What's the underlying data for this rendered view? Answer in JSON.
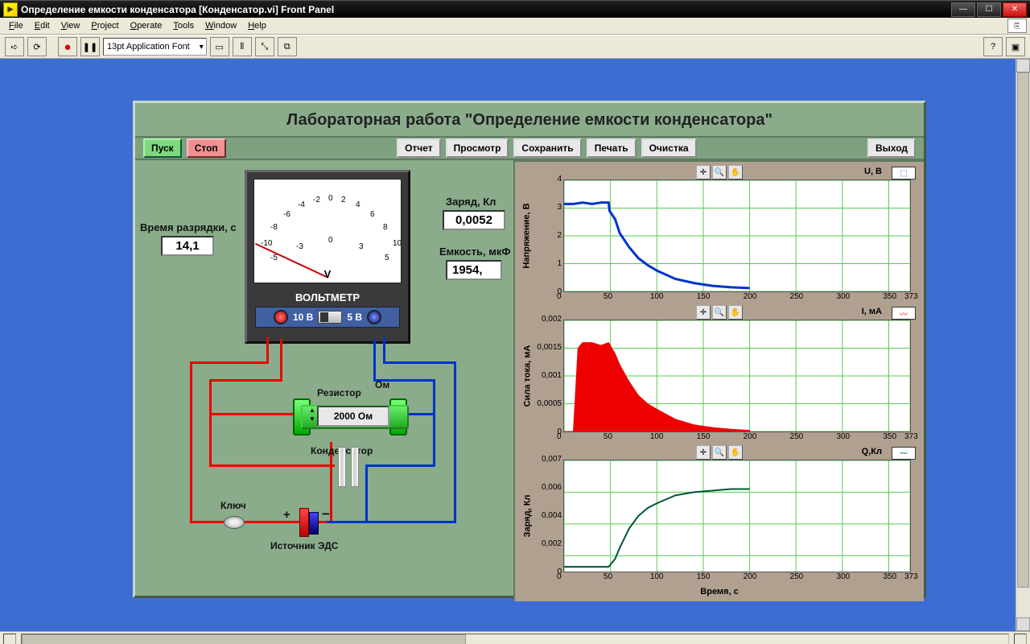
{
  "window": {
    "title": "Определение емкости конденсатора [Конденсатор.vi] Front Panel"
  },
  "menu": {
    "file": "File",
    "edit": "Edit",
    "view": "View",
    "project": "Project",
    "operate": "Operate",
    "tools": "Tools",
    "window": "Window",
    "help": "Help"
  },
  "toolbar": {
    "font": "13pt Application Font"
  },
  "panel": {
    "title": "Лабораторная работа \"Определение емкости конденсатора\""
  },
  "buttons": {
    "start": "Пуск",
    "stop": "Стоп",
    "report": "Отчет",
    "preview": "Просмотр",
    "save": "Сохранить",
    "print": "Печать",
    "clear": "Очистка",
    "exit": "Выход"
  },
  "labels": {
    "discharge_time": "Время разрядки, с",
    "charge": "Заряд, Кл",
    "capacity": "Емкость, мкФ",
    "voltmeter": "ВОЛЬТМЕТР",
    "v": "V",
    "r10": "10 В",
    "r5": "5 В",
    "resistor": "Резистор",
    "ohm": "Ом",
    "capacitor": "Конденсатор",
    "switch": "Ключ",
    "source": "Источник ЭДС",
    "plus": "+",
    "minus": "−"
  },
  "values": {
    "time": "14,1",
    "charge": "0,0052",
    "capacity": "1954,",
    "resistor": "2000 Ом"
  },
  "scale": {
    "n5": "-5",
    "n3": "-3",
    "0": "0",
    "3": "3",
    "5": "5",
    "top": {
      "n10": "-10",
      "n8": "-8",
      "n6": "-6",
      "n4": "-4",
      "n2": "-2",
      "0": "0",
      "2": "2",
      "4": "4",
      "6": "6",
      "8": "8",
      "10": "10"
    }
  },
  "graphs": {
    "g1": {
      "title": "U, В",
      "ylabel": "Напряжение, В",
      "yticks": [
        "4",
        "3",
        "2",
        "1",
        "0"
      ]
    },
    "g2": {
      "title": "I, мА",
      "ylabel": "Сила тока, мА",
      "yticks": [
        "0,002",
        "0,0015",
        "0,001",
        "0,0005",
        "0"
      ]
    },
    "g3": {
      "title": "Q,Кл",
      "ylabel": "Заряд, Кл",
      "yticks": [
        "0,007",
        "0,006",
        "0,004",
        "0,002",
        "0"
      ]
    },
    "xticks": [
      "0",
      "50",
      "100",
      "150",
      "200",
      "250",
      "300",
      "350",
      "373"
    ],
    "xlabel": "Время, с"
  },
  "chart_data": [
    {
      "type": "line",
      "title": "U, В",
      "xlabel": "Время, с",
      "ylabel": "Напряжение, В",
      "xlim": [
        0,
        373
      ],
      "ylim": [
        0,
        4
      ],
      "x": [
        0,
        10,
        20,
        30,
        40,
        48,
        49,
        55,
        60,
        70,
        80,
        90,
        100,
        120,
        140,
        160,
        180,
        200
      ],
      "y": [
        3.15,
        3.15,
        3.2,
        3.15,
        3.2,
        3.2,
        2.9,
        2.6,
        2.1,
        1.6,
        1.2,
        0.95,
        0.75,
        0.45,
        0.3,
        0.2,
        0.15,
        0.12
      ]
    },
    {
      "type": "area",
      "title": "I, мА",
      "xlabel": "Время, с",
      "ylabel": "Сила тока, мА",
      "xlim": [
        0,
        373
      ],
      "ylim": [
        0,
        0.002
      ],
      "x": [
        0,
        10,
        15,
        20,
        30,
        40,
        48,
        55,
        60,
        70,
        80,
        90,
        100,
        120,
        140,
        160,
        180,
        200
      ],
      "y": [
        0,
        0,
        0.0015,
        0.0016,
        0.0016,
        0.00155,
        0.0016,
        0.0014,
        0.0012,
        0.0009,
        0.00065,
        0.0005,
        0.0004,
        0.00022,
        0.00012,
        7e-05,
        4e-05,
        2e-05
      ]
    },
    {
      "type": "line",
      "title": "Q,Кл",
      "xlabel": "Время, с",
      "ylabel": "Заряд, Кл",
      "xlim": [
        0,
        373
      ],
      "ylim": [
        0,
        0.007
      ],
      "x": [
        0,
        20,
        40,
        48,
        55,
        60,
        70,
        80,
        90,
        100,
        120,
        140,
        160,
        180,
        200
      ],
      "y": [
        0.0003,
        0.0003,
        0.0003,
        0.0003,
        0.0008,
        0.0015,
        0.0027,
        0.0035,
        0.004,
        0.0043,
        0.0048,
        0.005,
        0.0051,
        0.0052,
        0.0052
      ]
    }
  ]
}
